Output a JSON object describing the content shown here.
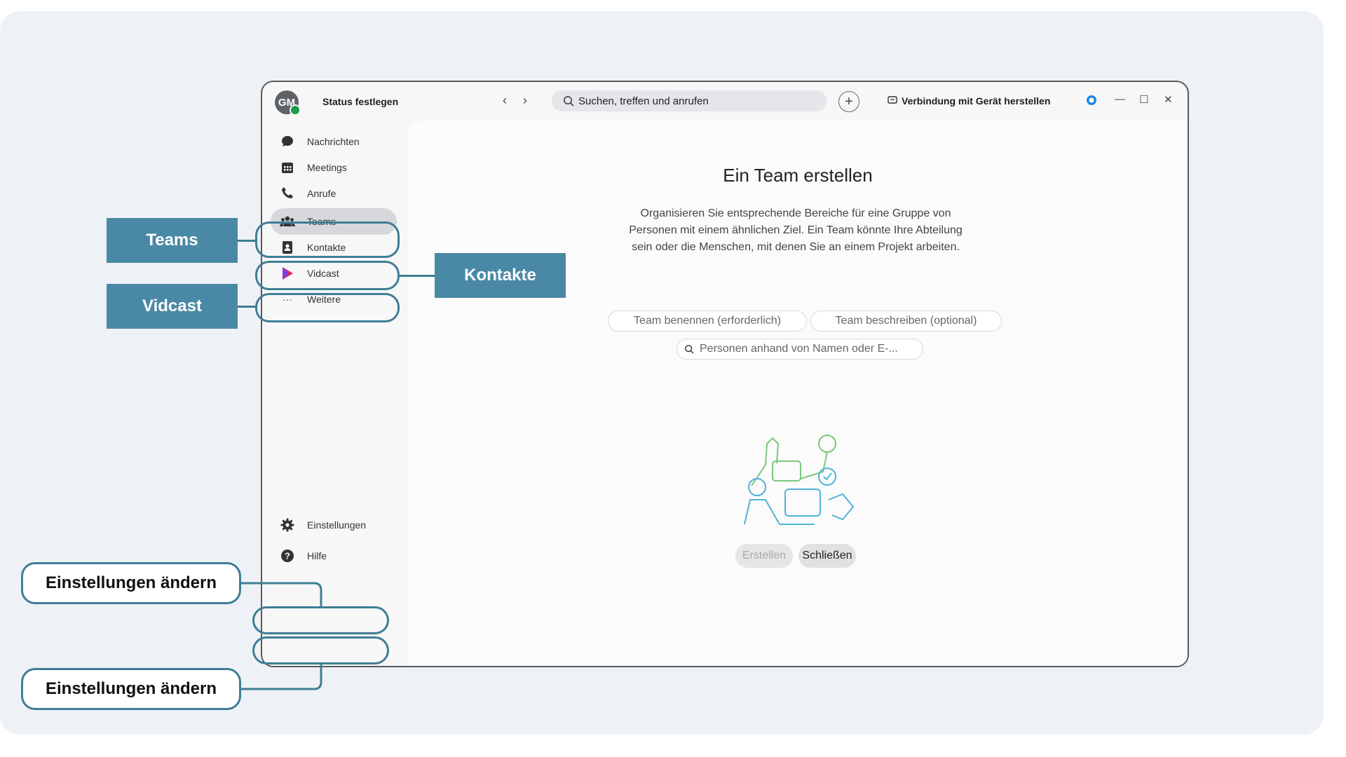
{
  "colors": {
    "callout_bg": "#4a89a5",
    "outline": "#3f7d96",
    "panel_bg": "#eef2f6",
    "status_online": "#1a9c4a"
  },
  "titlebar": {
    "avatar_initials": "GM",
    "status_label": "Status festlegen",
    "search_placeholder": "Suchen, treffen und anrufen",
    "device_label": "Verbindung mit Gerät herstellen"
  },
  "sidebar": {
    "items": [
      {
        "label": "Nachrichten",
        "icon": "chat-icon"
      },
      {
        "label": "Meetings",
        "icon": "calendar-icon"
      },
      {
        "label": "Anrufe",
        "icon": "phone-icon"
      },
      {
        "label": "Teams",
        "icon": "teams-icon",
        "active": true
      },
      {
        "label": "Kontakte",
        "icon": "contacts-icon"
      },
      {
        "label": "Vidcast",
        "icon": "vidcast-icon"
      },
      {
        "label": "Weitere",
        "icon": "more-icon"
      }
    ],
    "bottom": [
      {
        "label": "Einstellungen",
        "icon": "gear-icon"
      },
      {
        "label": "Hilfe",
        "icon": "help-icon"
      }
    ]
  },
  "dialog": {
    "title": "Ein Team erstellen",
    "description": "Organisieren Sie entsprechende Bereiche für eine Gruppe von Personen mit einem ähnlichen Ziel. Ein Team könnte Ihre Abteilung sein oder die Menschen, mit denen Sie an einem Projekt arbeiten.",
    "name_placeholder": "Team benennen (erforderlich)",
    "desc_placeholder": "Team beschreiben (optional)",
    "people_placeholder": "Personen anhand von Namen oder E-...",
    "create_button": "Erstellen",
    "close_button": "Schließen"
  },
  "annotations": {
    "teams": "Teams",
    "vidcast": "Vidcast",
    "kontakte": "Kontakte",
    "settings_1": "Einstellungen ändern",
    "settings_2": "Einstellungen ändern"
  }
}
